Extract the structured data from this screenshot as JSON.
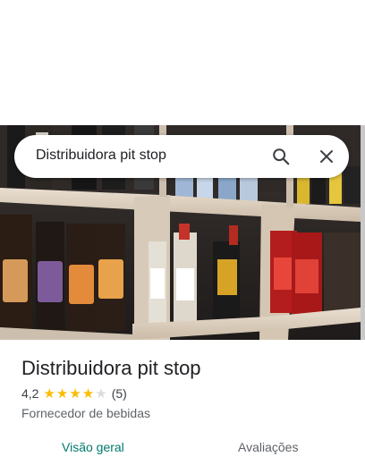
{
  "search": {
    "query": "Distribuidora pit stop"
  },
  "place": {
    "name": "Distribuidora pit stop",
    "rating": "4,2",
    "rating_value": 4.2,
    "reviews_count": "(5)",
    "category": "Fornecedor de bebidas"
  },
  "tabs": [
    {
      "label": "Visão geral",
      "active": true
    },
    {
      "label": "Avaliações",
      "active": false
    }
  ],
  "colors": {
    "accent": "#00796b",
    "star": "#fbbc04",
    "star_empty": "#dadce0",
    "tab_inactive": "#5f6368"
  },
  "icons": {
    "search": "search-icon",
    "close": "close-icon"
  }
}
